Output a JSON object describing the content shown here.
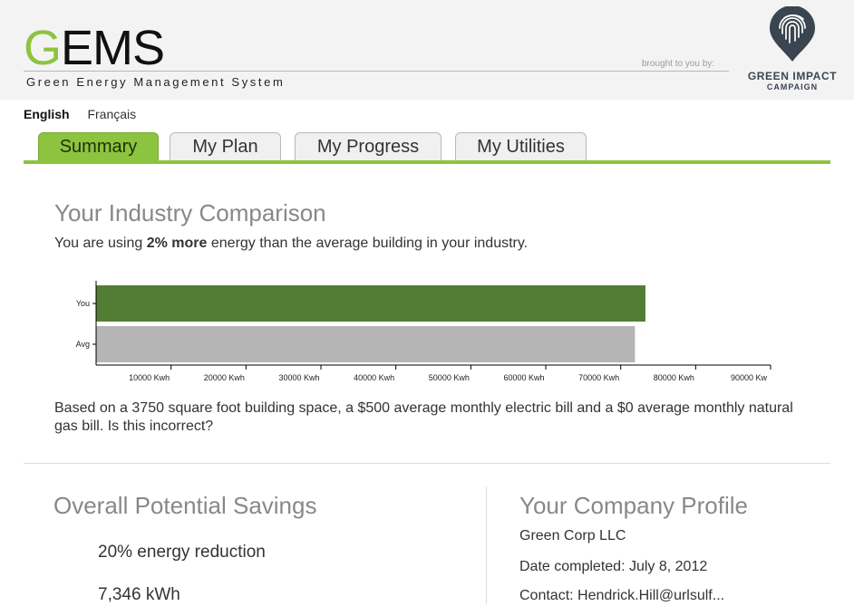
{
  "header": {
    "logo_first": "G",
    "logo_rest": "EMS",
    "tagline": "Green Energy Management System",
    "brought_by": "brought to you by:",
    "partner_title": "GREEN IMPACT",
    "partner_sub": "CAMPAIGN",
    "partner_icon": "fingerprint-pin-icon"
  },
  "languages": {
    "english": "English",
    "french": "Français",
    "active": "English"
  },
  "tabs": [
    {
      "label": "Summary",
      "active": true
    },
    {
      "label": "My Plan",
      "active": false
    },
    {
      "label": "My Progress",
      "active": false
    },
    {
      "label": "My Utilities",
      "active": false
    }
  ],
  "comparison": {
    "title": "Your Industry Comparison",
    "sentence_start": "You are using ",
    "sentence_bold": "2% more",
    "sentence_end": " energy than the average building in your industry.",
    "basis": "Based on a 3750 square foot building space, a $500 average monthly electric bill and a $0 average monthly natural gas bill. Is this incorrect?"
  },
  "chart_data": {
    "type": "bar",
    "orientation": "horizontal",
    "categories": [
      "You",
      "Avg"
    ],
    "values": [
      73300,
      71900
    ],
    "colors": [
      "#537d34",
      "#b5b5b5"
    ],
    "xlim": [
      0,
      90000
    ],
    "xticks": [
      10000,
      20000,
      30000,
      40000,
      50000,
      60000,
      70000,
      80000,
      90000
    ],
    "xtick_labels": [
      "10000 Kwh",
      "20000 Kwh",
      "30000 Kwh",
      "40000 Kwh",
      "50000 Kwh",
      "60000 Kwh",
      "70000 Kwh",
      "80000 Kwh",
      "90000 Kw"
    ],
    "title": "",
    "xlabel": "",
    "ylabel": "",
    "grid": false
  },
  "savings": {
    "title": "Overall Potential Savings",
    "reduction": "20% energy reduction",
    "kwh_partial": "7,346 kWh"
  },
  "profile": {
    "title": "Your Company Profile",
    "company": "Green Corp LLC",
    "date_completed": "Date completed: July 8, 2012",
    "contact_partial": "Contact: Hendrick.Hill@urlsulf..."
  }
}
